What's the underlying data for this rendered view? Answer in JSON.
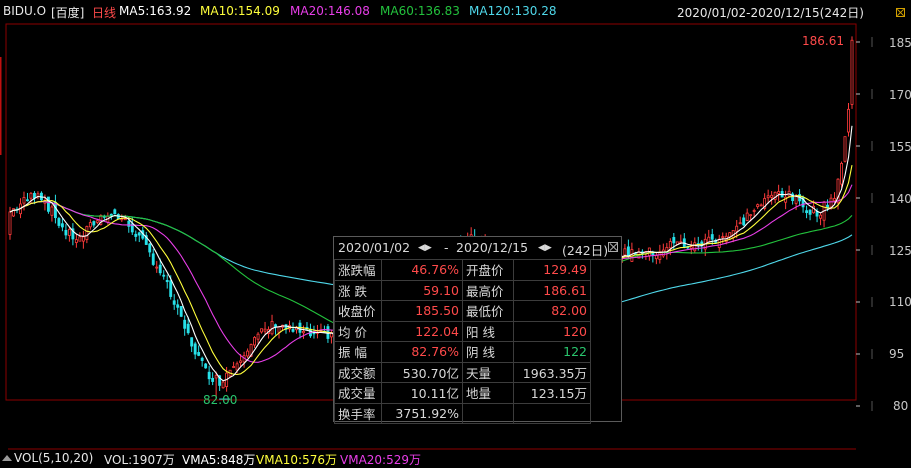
{
  "header": {
    "symbol": "BIDU.O",
    "name": "[百度]",
    "period": "日线",
    "ma5": "MA5:163.92",
    "ma10": "MA10:154.09",
    "ma20": "MA20:146.08",
    "ma60": "MA60:136.83",
    "ma120": "MA120:130.28",
    "range": "2020/01/02-2020/12/15(242日)"
  },
  "colors": {
    "up": "#ff3b3b",
    "down": "#27e0e8",
    "ma5": "#ffffff",
    "ma10": "#ffff3c",
    "ma20": "#e83ee8",
    "ma60": "#23c23d",
    "ma120": "#4fd8ea",
    "grid": "#8b0000"
  },
  "y_axis": {
    "ticks": [
      "185",
      "170",
      "155",
      "140",
      "125",
      "110",
      "95",
      "80"
    ]
  },
  "markers": {
    "high": "186.61",
    "low": "82.00"
  },
  "stats": {
    "date_from": "2020/01/02",
    "date_to": "2020/12/15",
    "days": "(242日)",
    "rows": [
      {
        "l1": "涨跌幅",
        "v1": "46.76%",
        "l2": "开盘价",
        "v2": "129.49"
      },
      {
        "l1": "涨  跌",
        "v1": "59.10",
        "l2": "最高价",
        "v2": "186.61"
      },
      {
        "l1": "收盘价",
        "v1": "185.50",
        "l2": "最低价",
        "v2": "82.00"
      },
      {
        "l1": "均  价",
        "v1": "122.04",
        "l2": "阳  线",
        "v2": "120"
      },
      {
        "l1": "振  幅",
        "v1": "82.76%",
        "l2": "阴  线",
        "v2": "122"
      },
      {
        "l1": "成交额",
        "v1": "530.70亿",
        "l2": "天量",
        "v2": "1963.35万"
      },
      {
        "l1": "成交量",
        "v1": "10.11亿",
        "l2": "地量",
        "v2": "123.15万"
      },
      {
        "l1": "换手率",
        "v1": "3751.92%",
        "l2": "",
        "v2": ""
      }
    ]
  },
  "volume_bar": {
    "label": "VOL(5,10,20)",
    "vol": "VOL:1907万",
    "vma5": "VMA5:848万",
    "vma10": "VMA10:576万",
    "vma20": "VMA20:529万"
  },
  "chart_data": {
    "type": "candlestick",
    "ylim": [
      80,
      190
    ],
    "start_date": "2020/01/02",
    "end_date": "2020/12/15",
    "trading_days": 242,
    "open": 129.49,
    "close": 185.5,
    "high": 186.61,
    "low": 82.0,
    "close_path": [
      [
        0,
        136
      ],
      [
        4,
        139
      ],
      [
        8,
        142
      ],
      [
        12,
        136
      ],
      [
        16,
        130
      ],
      [
        20,
        128
      ],
      [
        24,
        133
      ],
      [
        28,
        136
      ],
      [
        32,
        134
      ],
      [
        36,
        130
      ],
      [
        40,
        124
      ],
      [
        44,
        117
      ],
      [
        48,
        107
      ],
      [
        52,
        98
      ],
      [
        56,
        90
      ],
      [
        60,
        87
      ],
      [
        64,
        92
      ],
      [
        68,
        97
      ],
      [
        72,
        101
      ],
      [
        76,
        104
      ],
      [
        80,
        102
      ],
      [
        84,
        101
      ],
      [
        88,
        100
      ],
      [
        92,
        101
      ],
      [
        96,
        97
      ],
      [
        100,
        100
      ],
      [
        104,
        98
      ],
      [
        108,
        100
      ],
      [
        112,
        101
      ],
      [
        120,
        105
      ],
      [
        124,
        118
      ],
      [
        128,
        127
      ],
      [
        132,
        128
      ],
      [
        136,
        127
      ],
      [
        140,
        125
      ],
      [
        150,
        124
      ],
      [
        160,
        123
      ],
      [
        170,
        122
      ],
      [
        176,
        124
      ],
      [
        180,
        125
      ],
      [
        184,
        124
      ],
      [
        190,
        127
      ],
      [
        196,
        126
      ],
      [
        200,
        128
      ],
      [
        204,
        129
      ],
      [
        208,
        131
      ],
      [
        212,
        136
      ],
      [
        216,
        139
      ],
      [
        220,
        142
      ],
      [
        224,
        140
      ],
      [
        228,
        137
      ],
      [
        232,
        136
      ],
      [
        236,
        141
      ],
      [
        238,
        150
      ],
      [
        240,
        165
      ],
      [
        241,
        185.5
      ]
    ],
    "moving_averages": [
      {
        "name": "MA5",
        "value": 163.92
      },
      {
        "name": "MA10",
        "value": 154.09
      },
      {
        "name": "MA20",
        "value": 146.08
      },
      {
        "name": "MA60",
        "value": 136.83
      },
      {
        "name": "MA120",
        "value": 130.28
      }
    ]
  }
}
